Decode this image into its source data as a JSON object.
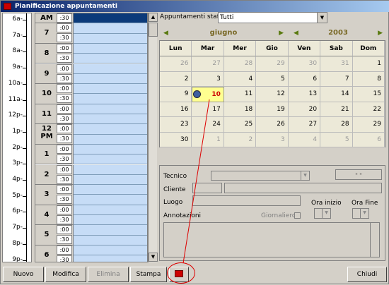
{
  "window": {
    "title": "Pianificazione appuntamenti"
  },
  "ruler": {
    "labels": [
      "6a-",
      "7a-",
      "8a-",
      "9a-",
      "10a-",
      "11a-",
      "12p-",
      "1p-",
      "2p-",
      "3p-",
      "4p-",
      "5p-",
      "6p-",
      "7p-",
      "8p-",
      "9p-"
    ]
  },
  "schedule": {
    "hours": [
      {
        "label": "AM",
        "m1": ":30",
        "m2": ""
      },
      {
        "label": "7",
        "m1": ":00",
        "m2": ":30"
      },
      {
        "label": "8",
        "m1": ":00",
        "m2": ":30"
      },
      {
        "label": "9",
        "m1": ":00",
        "m2": ":30"
      },
      {
        "label": "10",
        "m1": ":00",
        "m2": ":30"
      },
      {
        "label": "11",
        "m1": ":00",
        "m2": ":30"
      },
      {
        "label": "12 PM",
        "m1": ":00",
        "m2": ":30"
      },
      {
        "label": "1",
        "m1": ":00",
        "m2": ":30"
      },
      {
        "label": "2",
        "m1": ":00",
        "m2": ":30"
      },
      {
        "label": "3",
        "m1": ":00",
        "m2": ":30"
      },
      {
        "label": "4",
        "m1": ":00",
        "m2": ":30"
      },
      {
        "label": "5",
        "m1": ":00",
        "m2": ":30"
      },
      {
        "label": "6",
        "m1": ":00",
        "m2": ":30"
      }
    ]
  },
  "staff": {
    "label": "Appuntamenti staff",
    "value": "Tutti"
  },
  "calendar": {
    "month": "giugno",
    "year": "2003",
    "weekdays": [
      "Lun",
      "Mar",
      "Mer",
      "Gio",
      "Ven",
      "Sab",
      "Dom"
    ],
    "weeks": [
      [
        "26",
        "27",
        "28",
        "29",
        "30",
        "31",
        "1"
      ],
      [
        "2",
        "3",
        "4",
        "5",
        "6",
        "7",
        "8"
      ],
      [
        "9",
        "10",
        "11",
        "12",
        "13",
        "14",
        "15"
      ],
      [
        "16",
        "17",
        "18",
        "19",
        "20",
        "21",
        "22"
      ],
      [
        "23",
        "24",
        "25",
        "26",
        "27",
        "28",
        "29"
      ],
      [
        "30",
        "1",
        "2",
        "3",
        "4",
        "5",
        "6"
      ]
    ],
    "off_cells": [
      [
        0,
        0
      ],
      [
        0,
        1
      ],
      [
        0,
        2
      ],
      [
        0,
        3
      ],
      [
        0,
        4
      ],
      [
        0,
        5
      ],
      [
        5,
        1
      ],
      [
        5,
        2
      ],
      [
        5,
        3
      ],
      [
        5,
        4
      ],
      [
        5,
        5
      ],
      [
        5,
        6
      ]
    ],
    "today": [
      2,
      1
    ]
  },
  "form": {
    "tecnico_label": "Tecnico",
    "time_display": "- -",
    "cliente_label": "Cliente",
    "luogo_label": "Luogo",
    "ora_inizio_label": "Ora inizio",
    "ora_fine_label": "Ora Fine",
    "annotazioni_label": "Annotazioni",
    "giornaliero_label": "Giornaliero"
  },
  "toolbar": {
    "nuovo": "Nuovo",
    "modifica": "Modifica",
    "elimina": "Elimina",
    "stampa": "Stampa",
    "chiudi": "Chiudi"
  },
  "colors": {
    "accent": "#0a246a",
    "slot": "#c6dcf6",
    "today": "#ffff90",
    "annotation": "#d00000"
  }
}
